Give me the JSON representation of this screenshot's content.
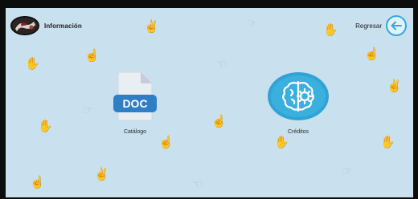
{
  "header": {
    "title": "Información",
    "back_label": "Regresar"
  },
  "tiles": [
    {
      "label": "Catálogo",
      "icon": "doc-file-icon",
      "badge": "DOC"
    },
    {
      "label": "Créditos",
      "icon": "gear-brain-icon"
    }
  ],
  "colors": {
    "background": "#c9e0ee",
    "accent": "#35a8e0",
    "doc_badge": "#2f7fc4",
    "credits_circle": "#2fa4d4"
  }
}
